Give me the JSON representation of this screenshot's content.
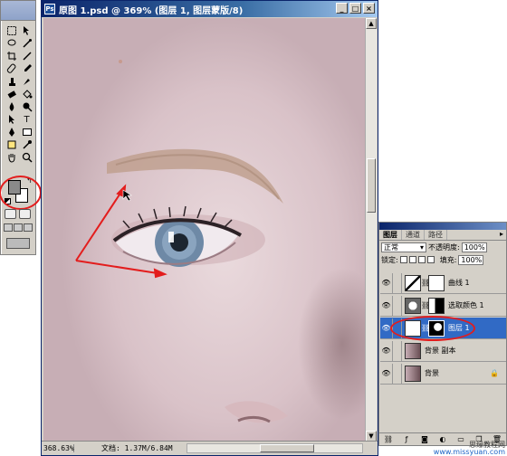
{
  "document": {
    "title": "原图 1.psd @ 369% (图层 1, 图层蒙版/8)",
    "zoom": "368.63%",
    "doc_info": "文档: 1.37M/6.84M"
  },
  "toolbox": {
    "foreground_color": "#8a8a8a",
    "background_color": "#ffffff"
  },
  "layers_panel": {
    "tabs": [
      "图层",
      "通道",
      "路径"
    ],
    "active_tab": "图层",
    "blend_mode": "正常",
    "opacity_label": "不透明度:",
    "opacity_value": "100%",
    "lock_label": "锁定:",
    "fill_label": "填充:",
    "fill_value": "100%",
    "layers": [
      {
        "name": "曲线 1",
        "type": "curves-adjustment",
        "visible": true,
        "active": false
      },
      {
        "name": "选取颜色 1",
        "type": "selective-color-adjustment",
        "visible": true,
        "active": false
      },
      {
        "name": "图层 1",
        "type": "layer-with-mask",
        "visible": true,
        "active": true
      },
      {
        "name": "背景 副本",
        "type": "image",
        "visible": true,
        "active": false
      },
      {
        "name": "背景",
        "type": "image-locked",
        "visible": true,
        "active": false
      }
    ]
  },
  "annotation_color": "#e31d1d",
  "watermark": {
    "line1": "思缘教程网",
    "line2": "www.missyuan.com"
  }
}
